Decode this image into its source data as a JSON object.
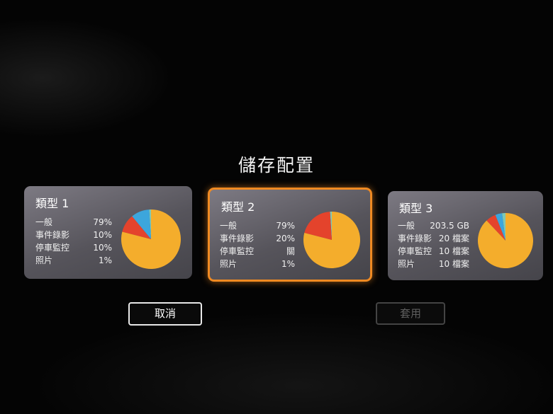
{
  "dialog": {
    "title": "儲存配置",
    "cancel_label": "取消",
    "apply_label": "套用"
  },
  "profiles": [
    {
      "name": "類型 1",
      "rows": [
        {
          "label": "一般",
          "value": "79%"
        },
        {
          "label": "事件錄影",
          "value": "10%"
        },
        {
          "label": "停車監控",
          "value": "10%"
        },
        {
          "label": "照片",
          "value": "1%"
        }
      ],
      "pie": [
        {
          "category": "一般",
          "percent": 79,
          "color": "#f4ad2c"
        },
        {
          "category": "事件錄影",
          "percent": 10,
          "color": "#e4432c"
        },
        {
          "category": "停車監控",
          "percent": 10,
          "color": "#3ca6dc"
        },
        {
          "category": "照片",
          "percent": 1,
          "color": "#7ec8b6"
        }
      ]
    },
    {
      "name": "類型 2",
      "selected": true,
      "rows": [
        {
          "label": "一般",
          "value": "79%"
        },
        {
          "label": "事件錄影",
          "value": "20%"
        },
        {
          "label": "停車監控",
          "value": "關"
        },
        {
          "label": "照片",
          "value": "1%"
        }
      ],
      "pie": [
        {
          "category": "一般",
          "percent": 79,
          "color": "#f4ad2c"
        },
        {
          "category": "事件錄影",
          "percent": 20,
          "color": "#e4432c"
        },
        {
          "category": "照片",
          "percent": 1,
          "color": "#7ec8b6"
        }
      ]
    },
    {
      "name": "類型 3",
      "rows": [
        {
          "label": "一般",
          "value": "203.5 GB"
        },
        {
          "label": "事件錄影",
          "value": "20 檔案"
        },
        {
          "label": "停車監控",
          "value": "10 檔案"
        },
        {
          "label": "照片",
          "value": "10 檔案"
        }
      ],
      "pie": [
        {
          "category": "一般",
          "percent": 88,
          "color": "#f4ad2c"
        },
        {
          "category": "事件錄影",
          "percent": 6,
          "color": "#e4432c"
        },
        {
          "category": "停車監控",
          "percent": 4,
          "color": "#3ca6dc"
        },
        {
          "category": "照片",
          "percent": 2,
          "color": "#7ec8b6"
        }
      ]
    }
  ],
  "colors": {
    "selected_border": "#f08a22",
    "general": "#f4ad2c",
    "event": "#e4432c",
    "parking": "#3ca6dc",
    "photo": "#7ec8b6"
  }
}
